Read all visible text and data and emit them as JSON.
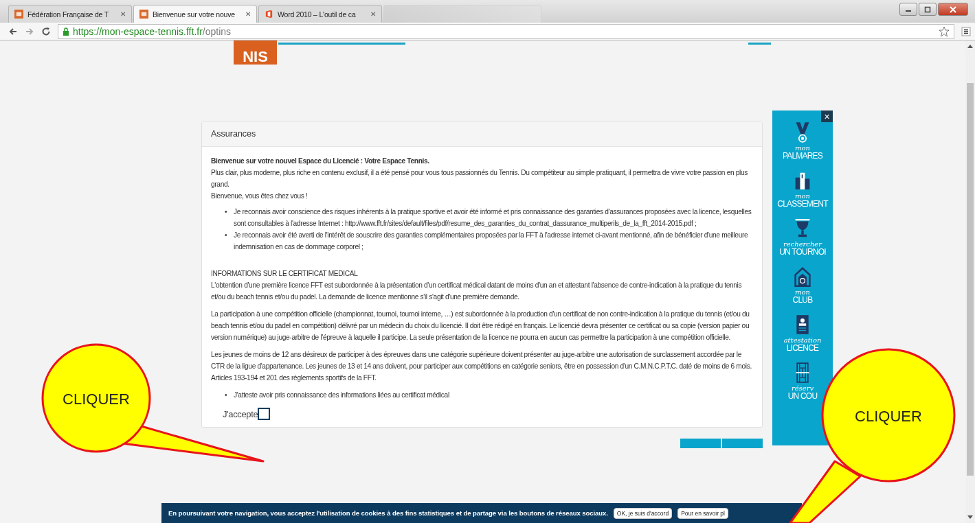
{
  "browser": {
    "tabs": [
      {
        "kind": "page",
        "title": "Fédération Française de T",
        "close": "✕",
        "selected": false
      },
      {
        "kind": "page",
        "title": "Bienvenue sur votre nouve",
        "close": "✕",
        "selected": true
      },
      {
        "kind": "page",
        "title": "Word 2010 – L'outil de ca",
        "close": "✕",
        "selected": false
      },
      {
        "kind": "blurred",
        "selected": false
      }
    ],
    "url_host": "https://mon-espace-tennis.fft.fr",
    "url_path": "/optins"
  },
  "logo": {
    "text": "NIS"
  },
  "card": {
    "title": "Assurances",
    "intro_title": "Bienvenue sur votre nouvel Espace du Licencié : Votre Espace Tennis.",
    "intro_lines": [
      "Plus clair, plus moderne, plus riche en contenu exclusif, il a été pensé pour vous tous passionnés du Tennis. Du compétiteur au simple pratiquant, il permettra de vivre votre passion en plus grand.",
      "Bienvenue, vous êtes chez vous !"
    ],
    "insurance_bullets": [
      {
        "marker": "•",
        "text": "Je reconnais avoir conscience des risques inhérents à la pratique sportive et avoir été informé et pris connaissance des garanties d'assurances proposées avec la licence, lesquelles sont consultables à l'adresse Internet : http://www.fft.fr/sites/default/files/pdf/resume_des_garanties_du_contrat_dassurance_multiperils_de_la_fft_2014-2015.pdf ;"
      },
      {
        "marker": "•",
        "text": "Je reconnais avoir été averti de l'intérêt de souscrire des garanties complémentaires proposées par la FFT à l'adresse internet ci-avant mentionné, afin de bénéficier d'une meilleure indemnisation en cas de dommage corporel ;"
      }
    ],
    "medical_heading": "INFORMATIONS SUR LE CERTIFICAT MEDICAL",
    "medical_paragraphs": [
      "L'obtention d'une première licence FFT est subordonnée à la présentation d'un certificat médical datant de moins d'un an et attestant l'absence de contre-indication à la pratique du tennis et/ou du beach tennis et/ou du padel. La demande de licence mentionne s'il s'agit d'une première demande.",
      "La participation à une compétition officielle (championnat, tournoi, tournoi interne, …) est subordonnée à la production d'un certificat de non contre-indication à la pratique du tennis (et/ou du beach tennis et/ou du padel en compétition) délivré par un médecin du choix du licencié. Il doit être rédigé en français. Le licencié devra présenter ce certificat ou sa copie (version papier ou version numérique) au juge-arbitre de l'épreuve à laquelle il participe. La seule présentation de la licence ne pourra en aucun cas permettre la participation à une compétition officielle.",
      "Les jeunes de moins de 12 ans désireux de participer à des épreuves dans une catégorie supérieure doivent présenter au juge-arbitre une autorisation de surclassement accordée par le CTR de la ligue d'appartenance. Les jeunes de 13 et 14 ans doivent, pour participer aux compétitions en catégorie seniors, être en possession d'un C.M.N.C.P.T.C. daté de moins de 6 mois. Articles 193-194 et 201 des règlements sportifs de la FFT."
    ],
    "medical_bullets": [
      {
        "marker": "•",
        "text": "J'atteste avoir pris connaissance des informations liées au certificat médical"
      }
    ],
    "accept": {
      "label": "J'accepte",
      "checked": false
    }
  },
  "side_panel": {
    "close": "×",
    "items": [
      {
        "script": "mon",
        "caption": "PALMARES"
      },
      {
        "script": "mon",
        "caption": "CLASSEMENT"
      },
      {
        "script": "rechercher",
        "caption": "UN TOURNOI"
      },
      {
        "script": "mon",
        "caption": "CLUB"
      },
      {
        "script": "attestation",
        "caption": "LICENCE"
      },
      {
        "script": "réserv",
        "caption": "UN COU"
      }
    ]
  },
  "cookie_bar": {
    "text": "En poursuivant votre navigation, vous acceptez l'utilisation de cookies à des fins statistiques et de partage via les boutons de réseaux sociaux.",
    "buttons": [
      "OK, je suis d'accord",
      "Pour en savoir pl"
    ]
  },
  "callouts": [
    {
      "text": "CLIQUER"
    },
    {
      "text": "CLIQUER"
    }
  ]
}
